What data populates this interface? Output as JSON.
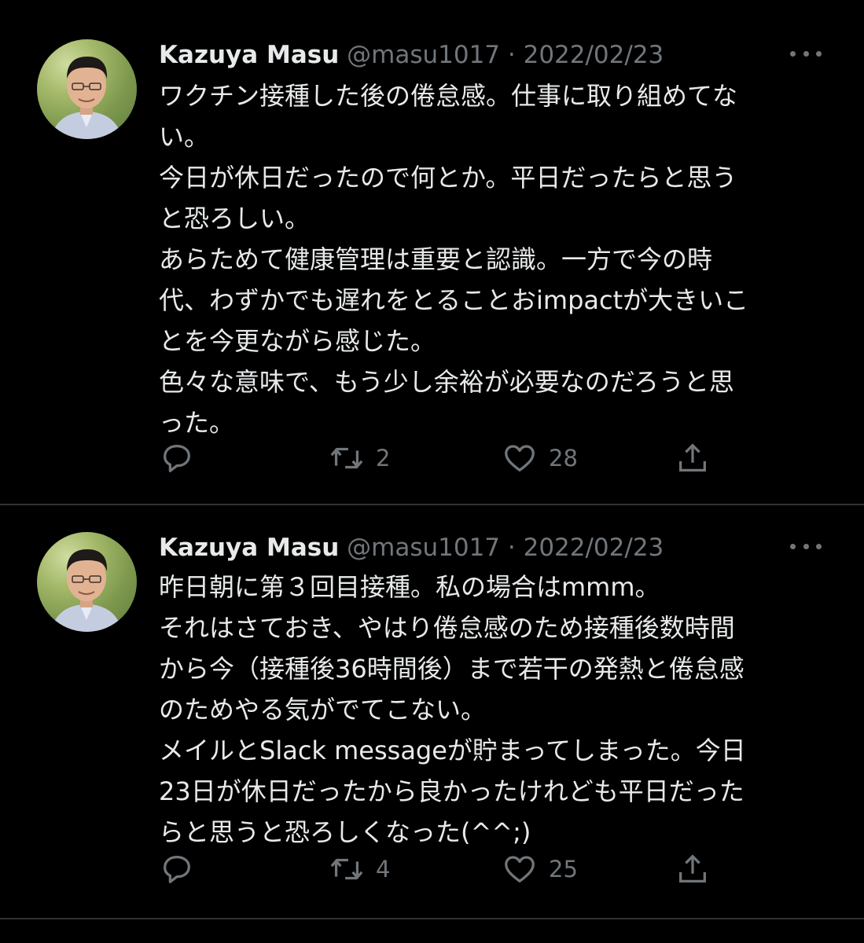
{
  "tweets": [
    {
      "author": {
        "name": "Kazuya Masu",
        "handle": "@masu1017"
      },
      "separator": "·",
      "date": "2022/02/23",
      "lines": [
        "ワクチン接種した後の倦怠感。仕事に取り組めてな",
        "い。",
        "今日が休日だったので何とか。平日だったらと思う",
        "と恐ろしい。",
        "あらためて健康管理は重要と認識。一方で今の時",
        "代、わずかでも遅れをとることおimpactが大きいこ",
        "とを今更ながら感じた。",
        "色々な意味で、もう少し余裕が必要なのだろうと思",
        "った。"
      ],
      "actions": {
        "reply_count": "",
        "retweet_count": "2",
        "like_count": "28"
      }
    },
    {
      "author": {
        "name": "Kazuya Masu",
        "handle": "@masu1017"
      },
      "separator": "·",
      "date": "2022/02/23",
      "lines": [
        "昨日朝に第３回目接種。私の場合はmmm。",
        "それはさておき、やはり倦怠感のため接種後数時間",
        "から今（接種後36時間後）まで若干の発熱と倦怠感",
        "のためやる気がでてこない。",
        "メイルとSlack messageが貯まってしまった。今日",
        "23日が休日だったから良かったけれども平日だった",
        "らと思うと恐ろしくなった(^^;)"
      ],
      "actions": {
        "reply_count": "",
        "retweet_count": "4",
        "like_count": "25"
      }
    }
  ],
  "icons": {
    "more": "more-horizontal-icon",
    "reply": "reply-icon",
    "retweet": "retweet-icon",
    "like": "heart-icon",
    "share": "share-icon"
  },
  "colors": {
    "background": "#000000",
    "text": "#e7e9ea",
    "secondary": "#71767b",
    "divider": "#2f3336"
  }
}
